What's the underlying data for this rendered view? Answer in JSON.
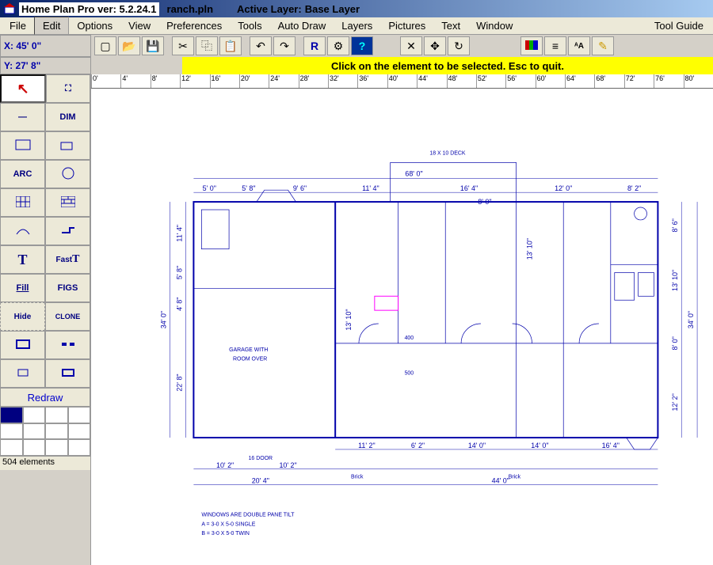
{
  "titlebar": {
    "app_title": "Home Plan Pro ver: 5.2.24.1",
    "filename": "ranch.pln",
    "active_layer_label": "Active Layer:",
    "active_layer_value": "Base Layer"
  },
  "menu": {
    "items": [
      "File",
      "Edit",
      "Options",
      "View",
      "Preferences",
      "Tools",
      "Auto Draw",
      "Layers",
      "Pictures",
      "Text",
      "Window",
      "Tool Guide"
    ]
  },
  "coords": {
    "x": "X: 45' 0\"",
    "y": "Y: 27' 8\""
  },
  "toolbar_icons": [
    "new-icon",
    "open-icon",
    "save-icon",
    "cut-icon",
    "copy-icon",
    "paste-icon",
    "undo-icon",
    "redo-icon",
    "refresh-icon",
    "unknown-icon",
    "help-icon",
    "delete-icon",
    "move-icon",
    "rotate-icon",
    "grid-icon",
    "colors-icon",
    "lineweight-icon",
    "textstyle-icon",
    "highlight-icon"
  ],
  "hint": "Click on the element to be selected.  Esc to quit.",
  "palette": {
    "rows": [
      [
        "arrow-tool",
        "select-tool"
      ],
      [
        "line-tool",
        "dim-tool"
      ],
      [
        "rect-tool",
        "door-tool"
      ],
      [
        "arc-tool",
        "circle-tool"
      ],
      [
        "pattern1-tool",
        "pattern2-tool"
      ],
      [
        "curve-tool",
        "wall-tool"
      ],
      [
        "text-tool",
        "fasttext-tool"
      ],
      [
        "fill-tool",
        "area-tool"
      ],
      [
        "hide-tool",
        "clone-tool"
      ],
      [
        "wallfull-tool",
        "break-tool"
      ],
      [
        "window-tool",
        "outline-tool"
      ]
    ],
    "labels": {
      "dim-tool": "DIM",
      "arc-tool": "ARC",
      "text-tool": "T",
      "fasttext-tool": "Fast",
      "fill-tool": "Fill",
      "area-tool": "FIGS",
      "hide-tool": "Hide",
      "clone-tool": "CLONE"
    },
    "redraw": "Redraw",
    "status": "504 elements"
  },
  "ruler": {
    "ticks": [
      "0'",
      "4'",
      "8'",
      "12'",
      "16'",
      "20'",
      "24'",
      "28'",
      "32'",
      "36'",
      "40'",
      "44'",
      "48'",
      "52'",
      "56'",
      "60'",
      "64'",
      "68'",
      "72'",
      "76'",
      "80'"
    ]
  },
  "floorplan": {
    "overall_width": "68' 0\"",
    "overall_height_left": "34' 0\"",
    "overall_height_right": "34' 0\"",
    "top_dims": [
      "5' 0\"",
      "5' 8\"",
      "9' 6\"",
      "11' 4\"",
      "16' 4\"",
      "12' 0\"",
      "8' 2\""
    ],
    "top_sub": [
      "8' 0\""
    ],
    "deck_label": "18 X 10 DECK",
    "left_dims": [
      "11' 4\"",
      "5' 8\"",
      "4' 8\"",
      "22' 8\""
    ],
    "right_dims": [
      "8' 6\"",
      "13' 10\"",
      "8' 0\"",
      "12' 2\""
    ],
    "mid_dims": [
      "13' 10\""
    ],
    "bottom_dims_inner": [
      "11' 2\"",
      "6' 2\"",
      "14' 0\"",
      "14' 0\"",
      "16' 4\""
    ],
    "bottom_dims_outer": [
      "10' 2\"",
      "10' 2\"",
      "20' 4\"",
      "44' 0\""
    ],
    "garage_label": "GARAGE WITH",
    "garage_label2": "ROOM OVER",
    "door_label": "16 DOOR",
    "brick_labels": [
      "Brick",
      "Brick"
    ],
    "note1": "WINDOWS ARE DOUBLE PANE TILT",
    "note2": "A = 3-0 X 5-0 SINGLE",
    "note3": "B = 3-0 X 5-0 TWIN",
    "misc_labels": [
      "400",
      "500"
    ]
  }
}
